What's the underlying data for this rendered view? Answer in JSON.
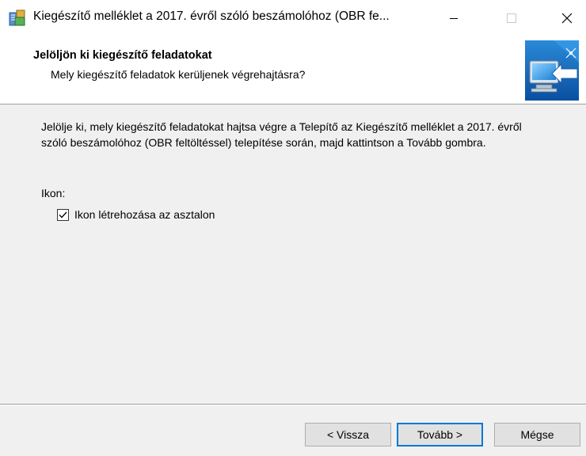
{
  "window": {
    "title": "Kiegészítő melléklet a 2017. évről szóló beszámolóhoz (OBR fe...",
    "icons": {
      "app": "installer-icon",
      "minimize": "minimize-icon",
      "maximize": "maximize-icon",
      "close": "close-icon"
    }
  },
  "header": {
    "title": "Jelöljön ki kiegészítő feladatokat",
    "subtitle": "Mely kiegészítő feladatok kerüljenek végrehajtásra?",
    "image": "wizard-computer-arrow-icon"
  },
  "main": {
    "description": "Jelölje ki, mely kiegészítő feladatokat hajtsa végre a Telepítő az Kiegészítő melléklet a 2017. évről szóló beszámolóhoz (OBR feltöltéssel) telepítése során, majd kattintson a Tovább gombra.",
    "group_label": "Ikon:",
    "tasks": [
      {
        "label": "Ikon létrehozása az asztalon",
        "checked": true
      }
    ]
  },
  "buttons": {
    "back": "< Vissza",
    "next": "Tovább >",
    "cancel": "Mégse"
  },
  "colors": {
    "accent": "#0078d7",
    "dialog_bg": "#f0f0f0",
    "header_bg": "#ffffff"
  }
}
